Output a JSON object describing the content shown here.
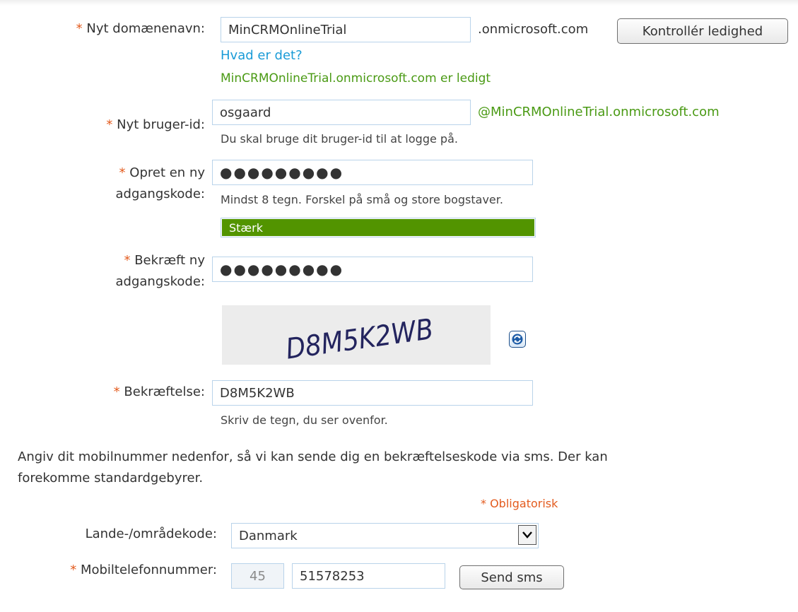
{
  "domain": {
    "required_mark": "*",
    "label": "Nyt domænenavn:",
    "value": "MinCRMOnlineTrial",
    "suffix": ".onmicrosoft.com",
    "check_button": "Kontrollér ledighed",
    "what_link": "Hvad er det?",
    "availability": "MinCRMOnlineTrial.onmicrosoft.com er ledigt"
  },
  "user_id": {
    "required_mark": "*",
    "label": "Nyt bruger-id:",
    "value": "osgaard",
    "suffix": "@MinCRMOnlineTrial.onmicrosoft.com",
    "hint": "Du skal bruge dit bruger-id til at logge på."
  },
  "password": {
    "required_mark": "*",
    "label_line1": "Opret en ny",
    "label_line2": "adgangskode:",
    "value": "●●●●●●●●●",
    "hint": "Mindst 8 tegn. Forskel på små og store bogstaver.",
    "strength_label": "Stærk",
    "strength_level": 1.0,
    "strength_color": "#529400"
  },
  "confirm_password": {
    "required_mark": "*",
    "label_line1": "Bekræft ny",
    "label_line2": "adgangskode:",
    "value": "●●●●●●●●●"
  },
  "captcha": {
    "text": "D8M5K2WB",
    "refresh_icon": "refresh-icon"
  },
  "confirmation": {
    "required_mark": "*",
    "label": "Bekræftelse:",
    "value": "D8M5K2WB",
    "hint": "Skriv de tegn, du ser ovenfor."
  },
  "mobile_info": {
    "line1": "Angiv dit mobilnummer nedenfor, så vi kan sende dig en bekræftelseskode via sms. Der kan",
    "line2": "forekomme standardgebyrer."
  },
  "required_note": "* Obligatorisk",
  "country": {
    "label": "Lande-/områdekode:",
    "selected": "Danmark"
  },
  "mobile": {
    "required_mark": "*",
    "label": "Mobiltelefonnummer:",
    "country_code": "45",
    "number": "51578253",
    "send_button": "Send sms"
  },
  "colors": {
    "required": "#e35b1e",
    "success": "#4a9a14",
    "link": "#1a9bd7",
    "input_border": "#b9d3ea"
  }
}
